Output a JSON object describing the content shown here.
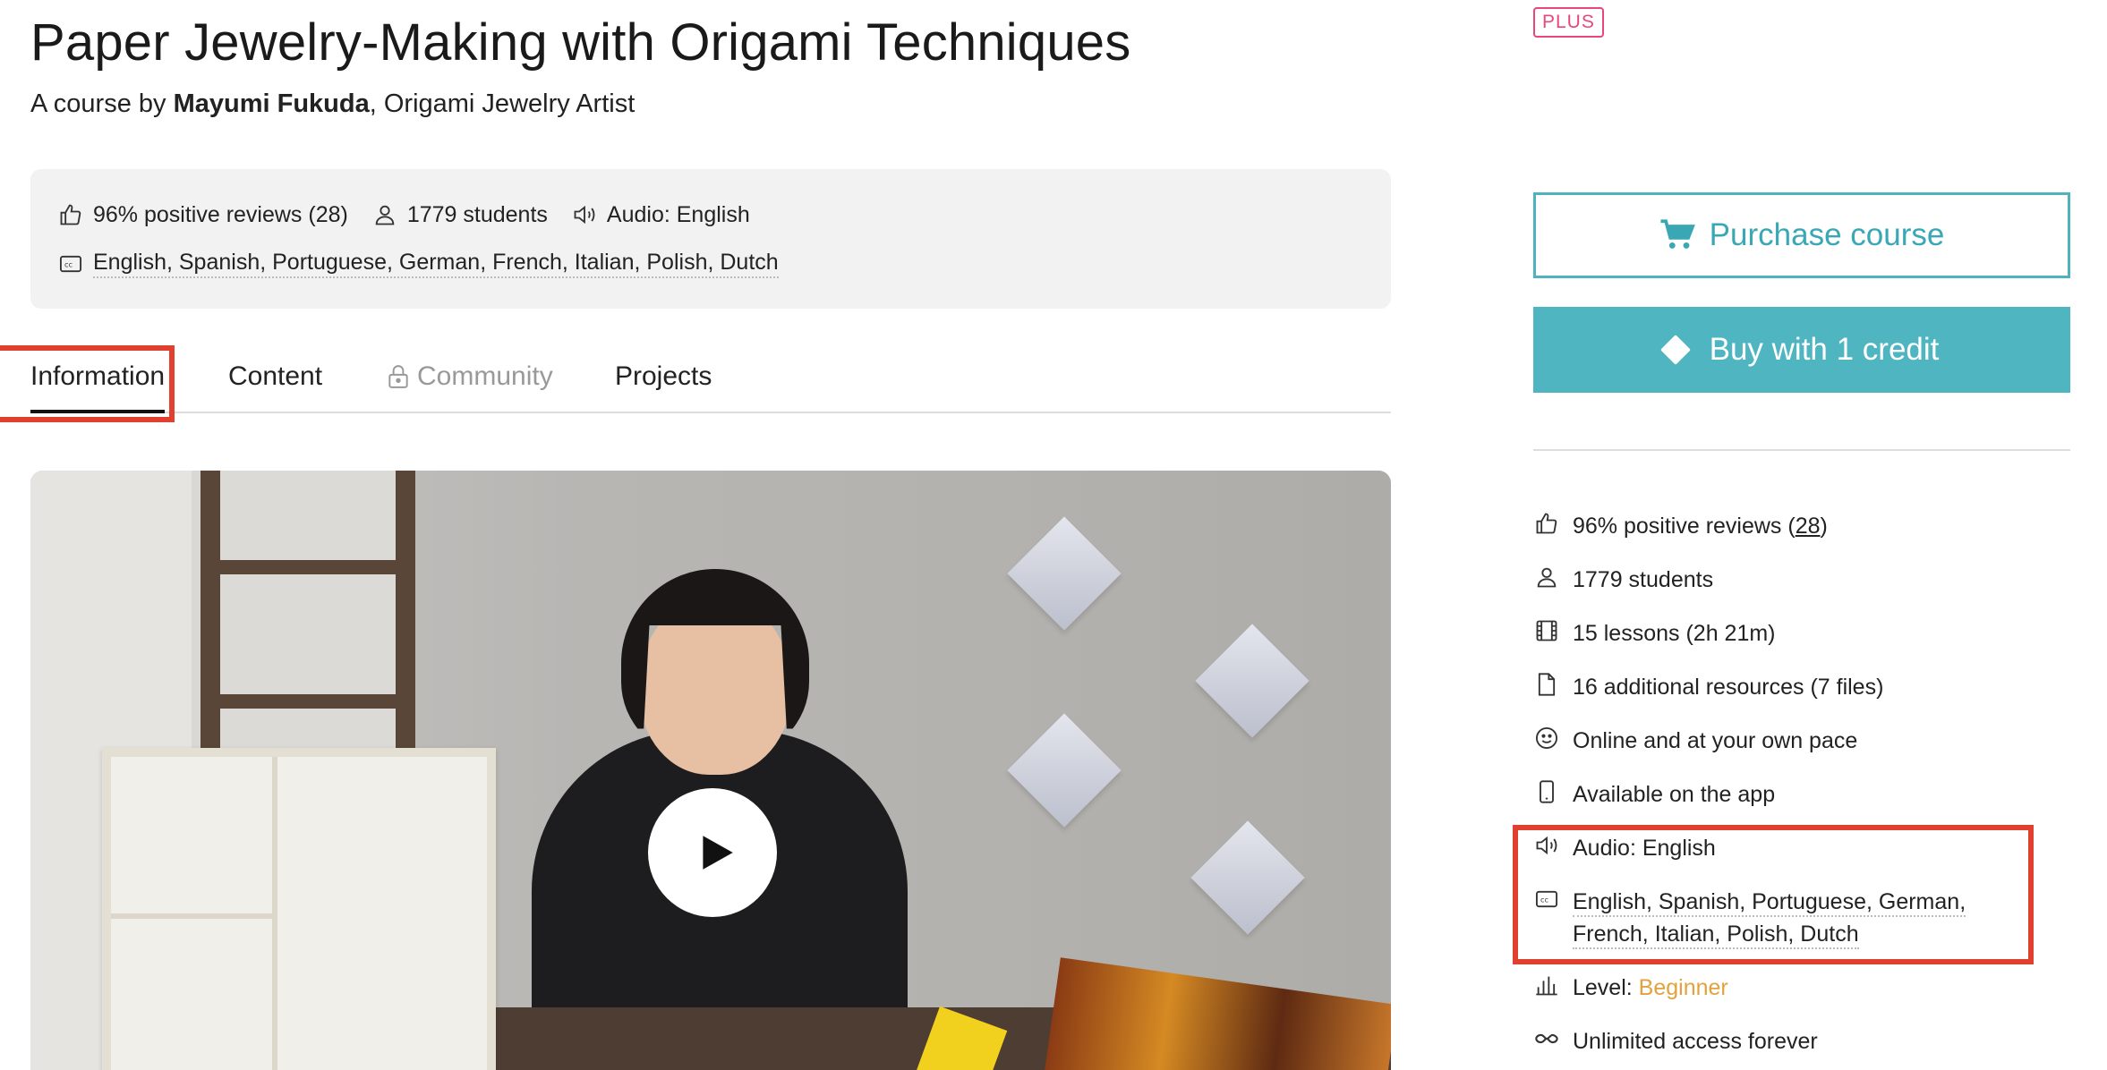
{
  "course": {
    "title": "Paper Jewelry-Making with Origami Techniques",
    "byline_prefix": "A course by ",
    "author": "Mayumi Fukuda",
    "author_role": ", Origami Jewelry Artist"
  },
  "stats": {
    "reviews": "96% positive reviews (28)",
    "students": "1779 students",
    "audio": "Audio: English",
    "subtitles": [
      "English",
      "Spanish",
      "Portuguese",
      "German",
      "French",
      "Italian",
      "Polish",
      "Dutch"
    ],
    "subtitles_text": "English, Spanish, Portuguese, German, French, Italian, Polish, Dutch"
  },
  "tabs": [
    {
      "label": "Information",
      "active": true
    },
    {
      "label": "Content",
      "active": false
    },
    {
      "label": "Community",
      "locked": true
    },
    {
      "label": "Projects",
      "active": false
    }
  ],
  "sidebar": {
    "badge": "PLUS",
    "purchase_label": "Purchase course",
    "credit_label": "Buy with 1 credit",
    "features": {
      "reviews_prefix": "96% positive reviews (",
      "reviews_count": "28",
      "reviews_suffix": ")",
      "students": "1779 students",
      "lessons": "15 lessons (2h 21m)",
      "resources": "16 additional resources (7 files)",
      "pace": "Online and at your own pace",
      "app": "Available on the app",
      "audio": "Audio: English",
      "subtitles_line1": "English, Spanish, Portuguese, German,",
      "subtitles_line2": "French, Italian, Polish, Dutch",
      "level_label": "Level: ",
      "level_value": "Beginner",
      "access": "Unlimited access forever"
    }
  },
  "colors": {
    "accent_teal": "#4fb6c1",
    "plus_pink": "#e8467c",
    "highlight_red": "#e2402f",
    "level_orange": "#e3a23c"
  },
  "icons": [
    "thumbs-up-icon",
    "user-icon",
    "speaker-icon",
    "closed-captions-icon",
    "lock-icon",
    "cart-icon",
    "diamond-icon",
    "film-icon",
    "file-icon",
    "smiley-icon",
    "phone-icon",
    "bar-chart-icon",
    "infinity-icon",
    "play-icon"
  ]
}
